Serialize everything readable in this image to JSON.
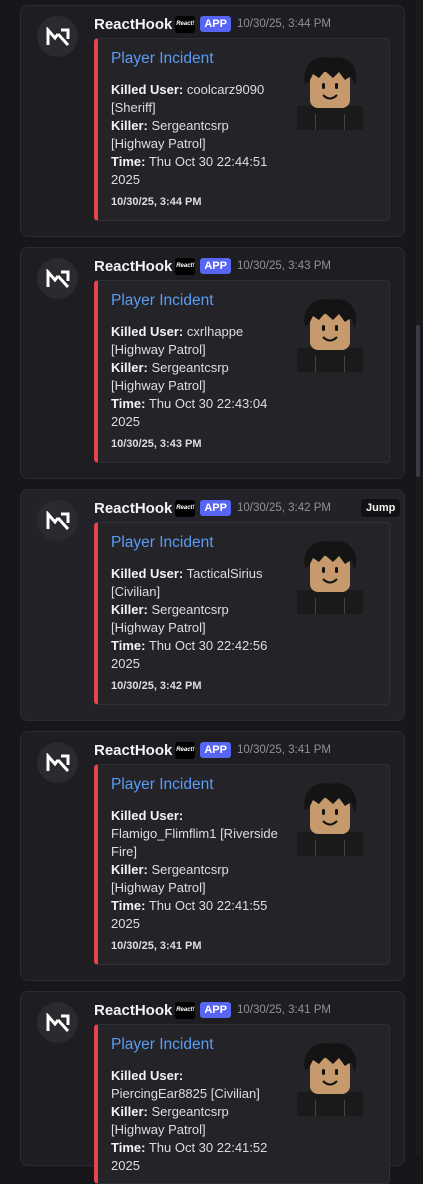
{
  "messages": [
    {
      "username": "ReactHook",
      "app_badge": "APP",
      "timestamp": "10/30/25, 3:44 PM",
      "embed": {
        "title": "Player Incident",
        "killed_user_label": "Killed User:",
        "killed_user": "coolcarz9090 [Sheriff]",
        "killer_label": "Killer:",
        "killer": "Sergeantcsrp [Highway Patrol]",
        "time_label": "Time:",
        "time": "Thu Oct 30 22:44:51 2025",
        "footer": "10/30/25, 3:44 PM"
      }
    },
    {
      "username": "ReactHook",
      "app_badge": "APP",
      "timestamp": "10/30/25, 3:43 PM",
      "embed": {
        "title": "Player Incident",
        "killed_user_label": "Killed User:",
        "killed_user": "cxrlhappe [Highway Patrol]",
        "killer_label": "Killer:",
        "killer": "Sergeantcsrp [Highway Patrol]",
        "time_label": "Time:",
        "time": "Thu Oct 30 22:43:04 2025",
        "footer": "10/30/25, 3:43 PM"
      }
    },
    {
      "username": "ReactHook",
      "app_badge": "APP",
      "timestamp": "10/30/25, 3:42 PM",
      "embed": {
        "title": "Player Incident",
        "killed_user_label": "Killed User:",
        "killed_user": "TacticalSirius [Civilian]",
        "killer_label": "Killer:",
        "killer": "Sergeantcsrp [Highway Patrol]",
        "time_label": "Time:",
        "time": "Thu Oct 30 22:42:56 2025",
        "footer": "10/30/25, 3:42 PM"
      }
    },
    {
      "username": "ReactHook",
      "app_badge": "APP",
      "timestamp": "10/30/25, 3:41 PM",
      "embed": {
        "title": "Player Incident",
        "killed_user_label": "Killed User:",
        "killed_user": "Flamigo_Flimflim1 [Riverside Fire]",
        "killer_label": "Killer:",
        "killer": "Sergeantcsrp [Highway Patrol]",
        "time_label": "Time:",
        "time": "Thu Oct 30 22:41:55 2025",
        "footer": "10/30/25, 3:41 PM"
      }
    },
    {
      "username": "ReactHook",
      "app_badge": "APP",
      "timestamp": "10/30/25, 3:41 PM",
      "embed": {
        "title": "Player Incident",
        "killed_user_label": "Killed User:",
        "killed_user": "PiercingEar8825 [Civilian]",
        "killer_label": "Killer:",
        "killer": "Sergeantcsrp [Highway Patrol]",
        "time_label": "Time:",
        "time": "Thu Oct 30 22:41:52 2025",
        "footer": ""
      }
    }
  ],
  "mini_logo_text": "React!",
  "hover_action": {
    "jump_label": "Jump"
  },
  "colors": {
    "accent_bar": "#e8434d",
    "title_link": "#5b9cf5",
    "app_badge": "#5865f2"
  },
  "icons": {
    "avatar": "reacthook-logo-icon",
    "thumbnail": "roblox-avatar-thumbnail"
  }
}
